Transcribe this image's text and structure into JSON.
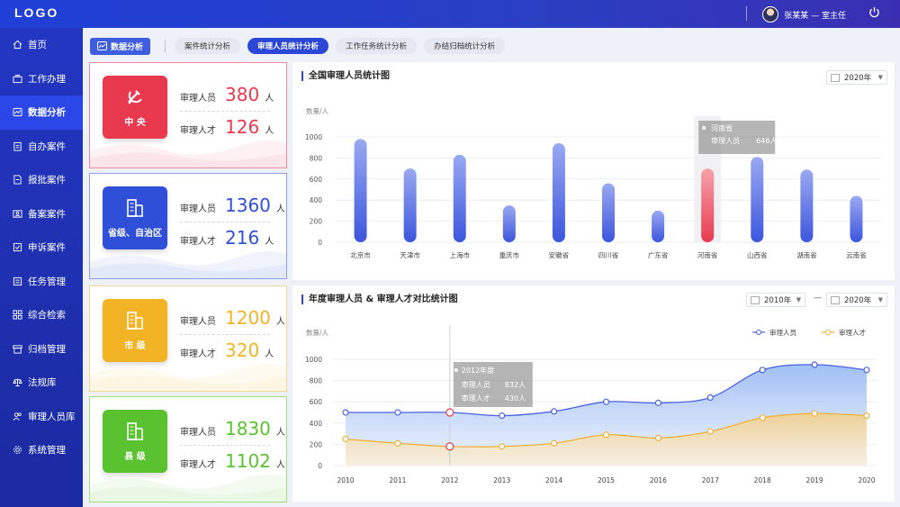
{
  "header": {
    "logo": "LOGO",
    "user_name": "张某某 — 室主任"
  },
  "sidebar": {
    "items": [
      {
        "label": "首页",
        "icon": "home-icon"
      },
      {
        "label": "工作办理",
        "icon": "briefcase-icon"
      },
      {
        "label": "数据分析",
        "icon": "analytics-icon",
        "active": true
      },
      {
        "label": "自办案件",
        "icon": "clipboard-icon"
      },
      {
        "label": "报批案件",
        "icon": "document-icon"
      },
      {
        "label": "备案案件",
        "icon": "id-card-icon"
      },
      {
        "label": "申诉案件",
        "icon": "appeal-icon"
      },
      {
        "label": "任务管理",
        "icon": "task-icon"
      },
      {
        "label": "综合检索",
        "icon": "grid-icon"
      },
      {
        "label": "归档管理",
        "icon": "archive-icon"
      },
      {
        "label": "法规库",
        "icon": "scale-icon"
      },
      {
        "label": "审理人员库",
        "icon": "people-icon"
      },
      {
        "label": "系统管理",
        "icon": "gear-icon"
      }
    ]
  },
  "tabs": {
    "home": "数据分析",
    "items": [
      {
        "label": "案件统计分析",
        "active": false
      },
      {
        "label": "审理人员统计分析",
        "active": true
      },
      {
        "label": "工作任务统计分析",
        "active": false
      },
      {
        "label": "办结归档统计分析",
        "active": false
      }
    ]
  },
  "cards": [
    {
      "name": "中 央",
      "staff_label": "审理人员",
      "staff": "380",
      "talent_label": "审理人才",
      "talent": "126",
      "unit": "人",
      "color": "#e8394f",
      "border": "#f08a96"
    },
    {
      "name": "省级、自治区",
      "staff_label": "审理人员",
      "staff": "1360",
      "talent_label": "审理人才",
      "talent": "216",
      "unit": "人",
      "color": "#2f4fd8",
      "border": "#8aa0ee"
    },
    {
      "name": "市 级",
      "staff_label": "审理人员",
      "staff": "1200",
      "talent_label": "审理人才",
      "talent": "320",
      "unit": "人",
      "color": "#f2b425",
      "border": "#f5d891"
    },
    {
      "name": "县 级",
      "staff_label": "审理人员",
      "staff": "1830",
      "talent_label": "审理人才",
      "talent": "1102",
      "unit": "人",
      "color": "#5ac12f",
      "border": "#9fdc82"
    }
  ],
  "panel1": {
    "title": "全国审理人员统计图",
    "year": "2020年"
  },
  "panel2": {
    "title": "年度审理人员 & 审理人才对比统计图",
    "year_from": "2010年",
    "dash": "—",
    "year_to": "2020年"
  },
  "colors": {
    "blue": "#4a63e0",
    "orange": "#f1b23a",
    "red": "#e8394f"
  },
  "chart_data": [
    {
      "type": "bar",
      "ylabel": "数量/人",
      "ylim": [
        0,
        1000
      ],
      "yticks": [
        0,
        200,
        400,
        600,
        800,
        1000
      ],
      "categories": [
        "北京市",
        "天津市",
        "上海市",
        "重庆市",
        "安徽省",
        "四川省",
        "广东省",
        "河南省",
        "山西省",
        "湖南省",
        "云南省"
      ],
      "values": [
        980,
        700,
        830,
        350,
        940,
        560,
        300,
        700,
        810,
        690,
        440
      ],
      "highlight": {
        "category": "河南省",
        "label": "审理人员",
        "value": "646人"
      }
    },
    {
      "type": "area",
      "ylabel": "数量/人",
      "ylim": [
        0,
        1000
      ],
      "yticks": [
        0,
        200,
        400,
        600,
        800,
        1000
      ],
      "x": [
        "2010",
        "2011",
        "2012",
        "2013",
        "2014",
        "2015",
        "2016",
        "2017",
        "2018",
        "2019",
        "2020"
      ],
      "series": [
        {
          "name": "审理人员",
          "values": [
            500,
            500,
            500,
            470,
            510,
            600,
            590,
            640,
            900,
            950,
            900
          ]
        },
        {
          "name": "审理人才",
          "values": [
            250,
            210,
            180,
            180,
            210,
            290,
            260,
            320,
            450,
            490,
            470
          ]
        }
      ],
      "tooltip": {
        "title": "2012年度",
        "rows": [
          {
            "label": "审理人员",
            "value": "832人"
          },
          {
            "label": "审理人才",
            "value": "430人"
          }
        ]
      }
    }
  ]
}
